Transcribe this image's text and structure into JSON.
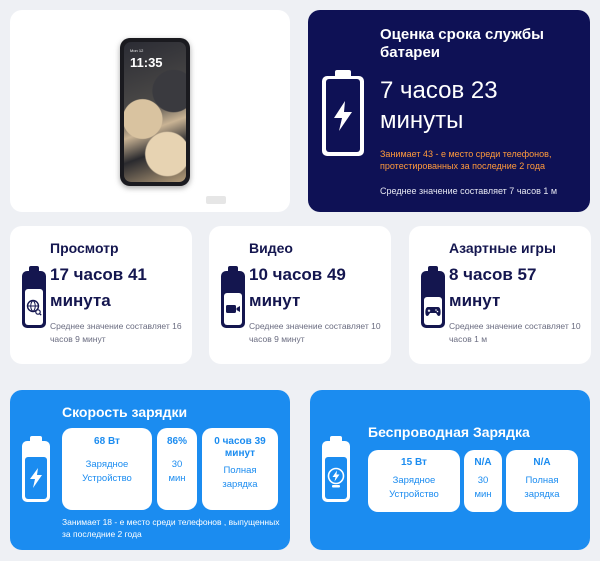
{
  "phone": {
    "date": "Mon 12",
    "time": "11:35",
    "sub": ""
  },
  "estimate": {
    "title": "Оценка срока службы батареи",
    "value": "7 часов 23 минуты",
    "rank": "Занимает 43 - е место среди телефонов, протестированных за последние 2 года",
    "average": "Среднее значение составляет 7 часов 1 м"
  },
  "usage": [
    {
      "title": "Просмотр",
      "value": "17 часов 41 минута",
      "average": "Среднее значение составляет 16 часов 9 минут",
      "icon": "globe-search-icon"
    },
    {
      "title": "Видео",
      "value": "10 часов 49 минут",
      "average": "Среднее значение составляет 10 часов 9 минут",
      "icon": "video-camera-icon"
    },
    {
      "title": "Азартные игры",
      "value": "8 часов 57 минут",
      "average": "Среднее значение составляет 10 часов 1 м",
      "icon": "gamepad-icon"
    }
  ],
  "charging": {
    "title": "Скорость зарядки",
    "power": {
      "value": "68 Вт",
      "label": "Зарядное Устройство"
    },
    "percent": {
      "value": "86%",
      "label": "30 мин"
    },
    "full": {
      "value": "0 часов 39 минут",
      "label": "Полная зарядка"
    },
    "rank": "Занимает 18 - е место среди телефонов , выпущенных за последние 2 года"
  },
  "wireless": {
    "title": "Беспроводная Зарядка",
    "power": {
      "value": "15 Вт",
      "label": "Зарядное Устройство"
    },
    "percent": {
      "value": "N/A",
      "label": "30 мин"
    },
    "full": {
      "value": "N/A",
      "label": "Полная зарядка"
    }
  },
  "colors": {
    "navy": "#0e1155",
    "blue": "#1b8cf0",
    "orange": "#ff9a3c",
    "dark_text": "#14164f"
  }
}
